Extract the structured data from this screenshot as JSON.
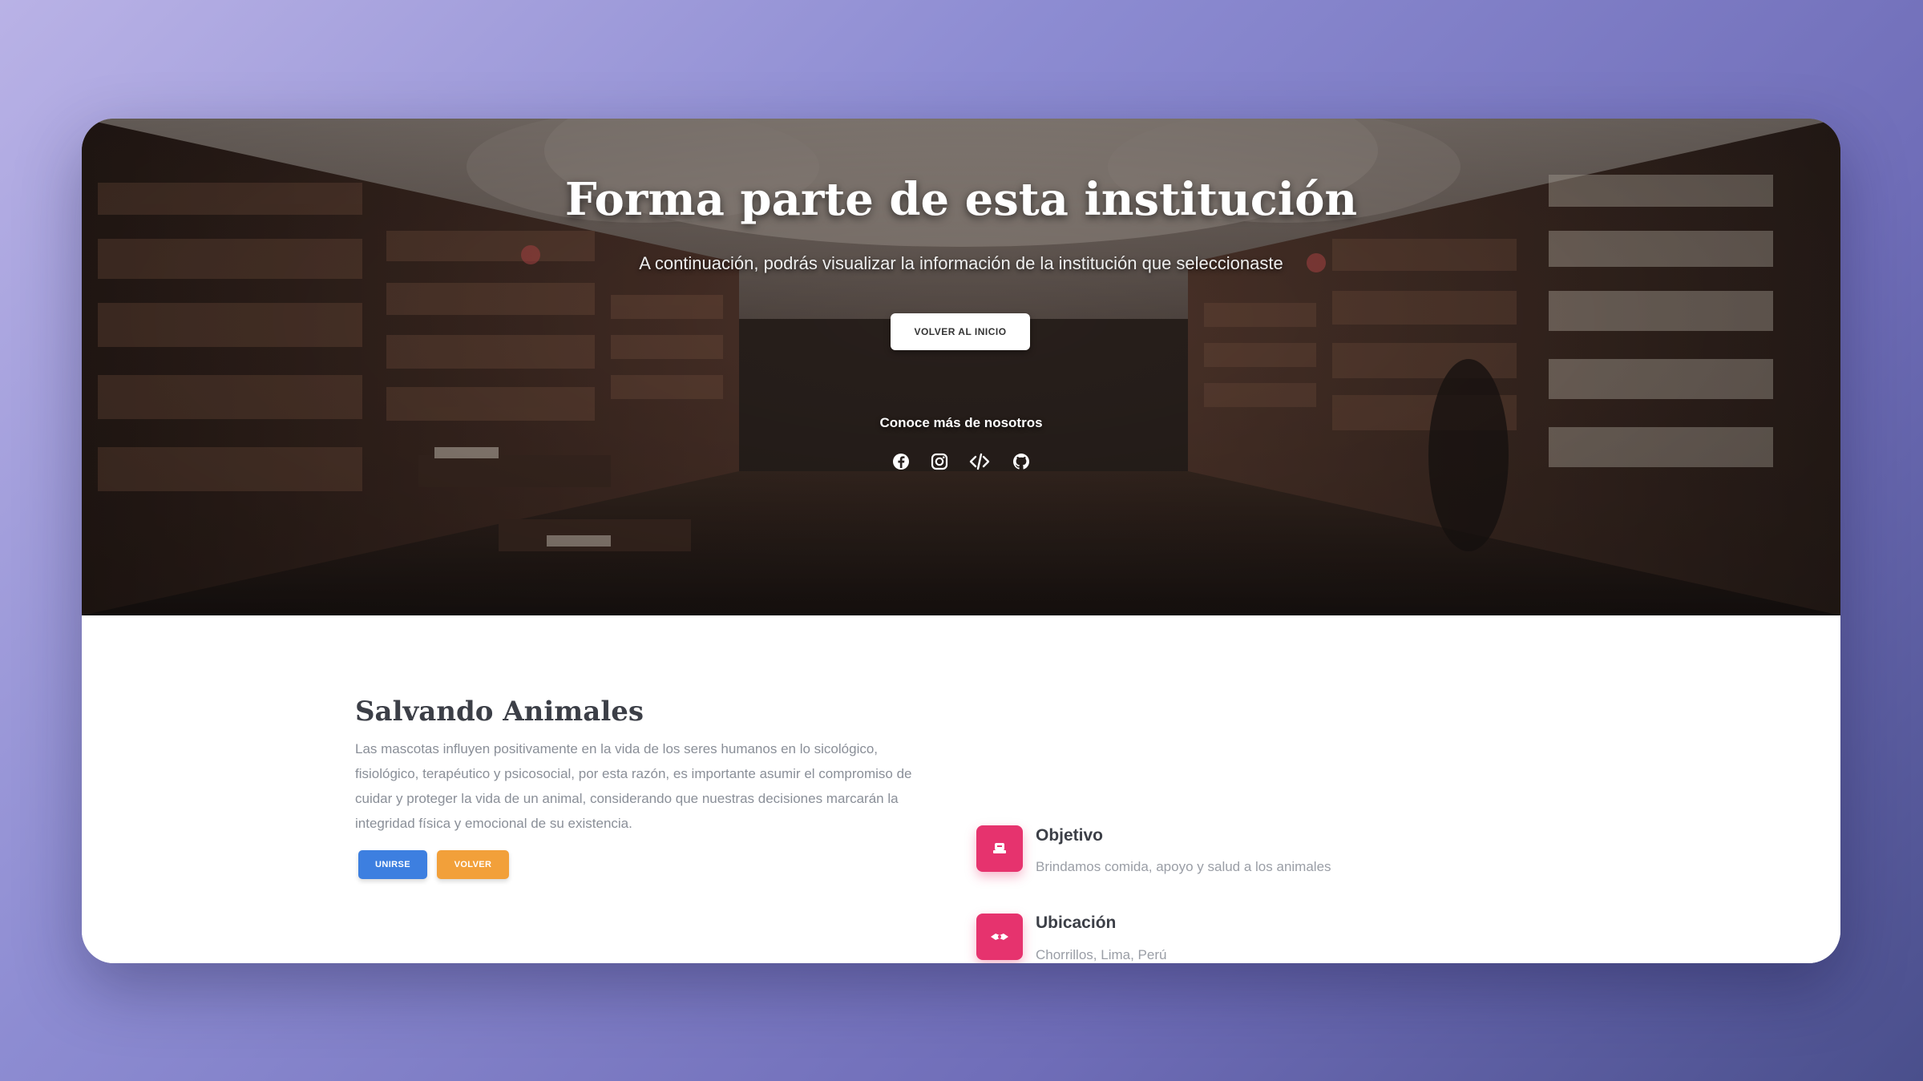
{
  "hero": {
    "title": "Forma parte de esta institución",
    "subtitle": "A continuación, podrás visualizar la información de la institución que seleccionaste",
    "button_label": "VOLVER AL INICIO",
    "know_more": "Conoce más de nosotros",
    "social_icons": [
      "facebook-icon",
      "instagram-icon",
      "code-icon",
      "github-icon"
    ]
  },
  "org": {
    "title": "Salvando Animales",
    "description": "Las mascotas influyen positivamente en la vida de los seres humanos en lo sicológico, fisiológico, terapéutico y psicosocial, por esta razón, es importante asumir el compromiso de cuidar y proteger la vida de un animal, considerando que nuestras decisiones marcarán la integridad física y emocional de su existencia.",
    "join_label": "UNIRSE",
    "back_label": "VOLVER"
  },
  "info": [
    {
      "label": "Objetivo",
      "text": "Brindamos comida, apoyo y salud a los animales",
      "icon": "target-icon"
    },
    {
      "label": "Ubicación",
      "text": "Chorrillos, Lima, Perú",
      "icon": "location-icon"
    }
  ],
  "colors": {
    "accent_pink": "#e6336e",
    "button_blue": "#3d7fe0",
    "button_orange": "#f2a03a"
  }
}
